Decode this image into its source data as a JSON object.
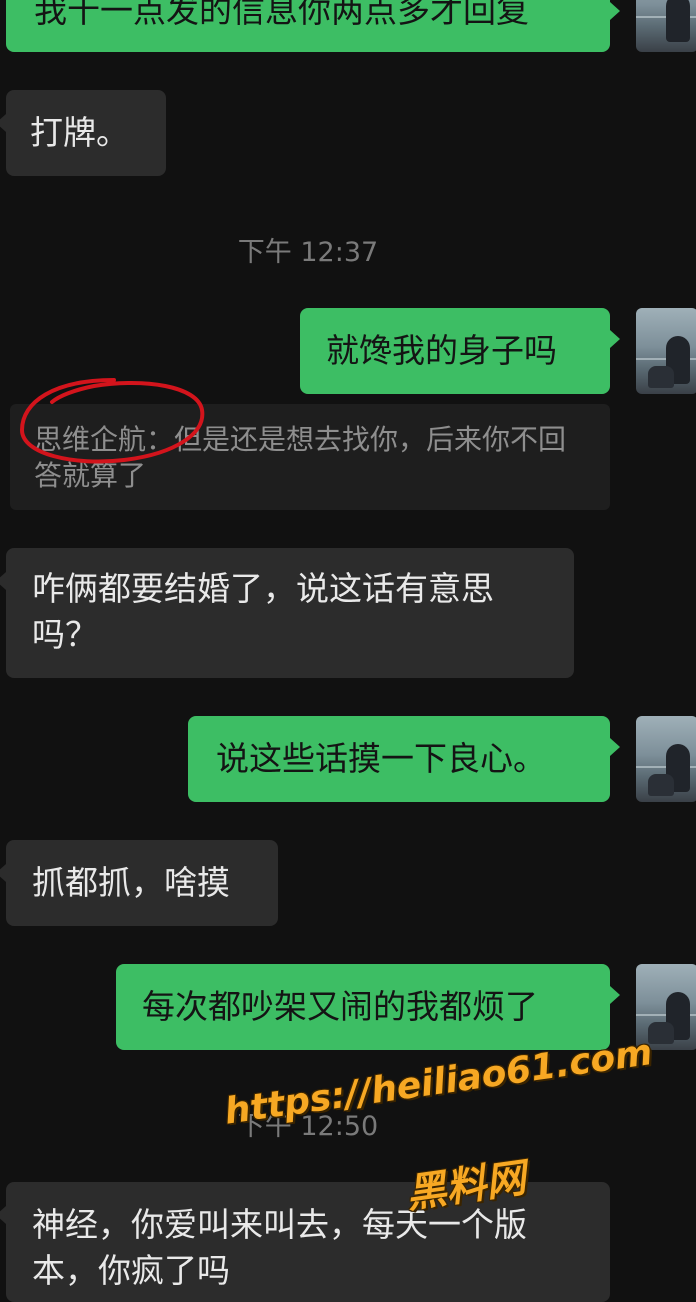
{
  "messages": [
    {
      "side": "sent",
      "text": "我十一点发的信息你两点多才回复"
    },
    {
      "side": "recv",
      "text": "打牌。"
    },
    {
      "side": "time",
      "text": "下午 12:37"
    },
    {
      "side": "sent",
      "text": "就馋我的身子吗"
    },
    {
      "side": "quote",
      "text": "思维企航：但是还是想去找你，后来你不回答就算了"
    },
    {
      "side": "recv",
      "text": "咋俩都要结婚了，说这话有意思吗？"
    },
    {
      "side": "sent",
      "text": "说这些话摸一下良心。"
    },
    {
      "side": "recv",
      "text": "抓都抓，啥摸"
    },
    {
      "side": "sent",
      "text": "每次都吵架又闹的我都烦了"
    },
    {
      "side": "time",
      "text": "下午 12:50"
    },
    {
      "side": "recv",
      "text": "神经，你爱叫来叫去，每天一个版本，你疯了吗"
    }
  ],
  "watermark": {
    "url": "https://heiliao61.com",
    "site_name": "黑料网",
    "color": "#f7a823"
  },
  "colors": {
    "background": "#111111",
    "sent_bubble": "#3dbe64",
    "recv_bubble": "#2c2c2c",
    "annotation_circle": "#d3141c"
  }
}
